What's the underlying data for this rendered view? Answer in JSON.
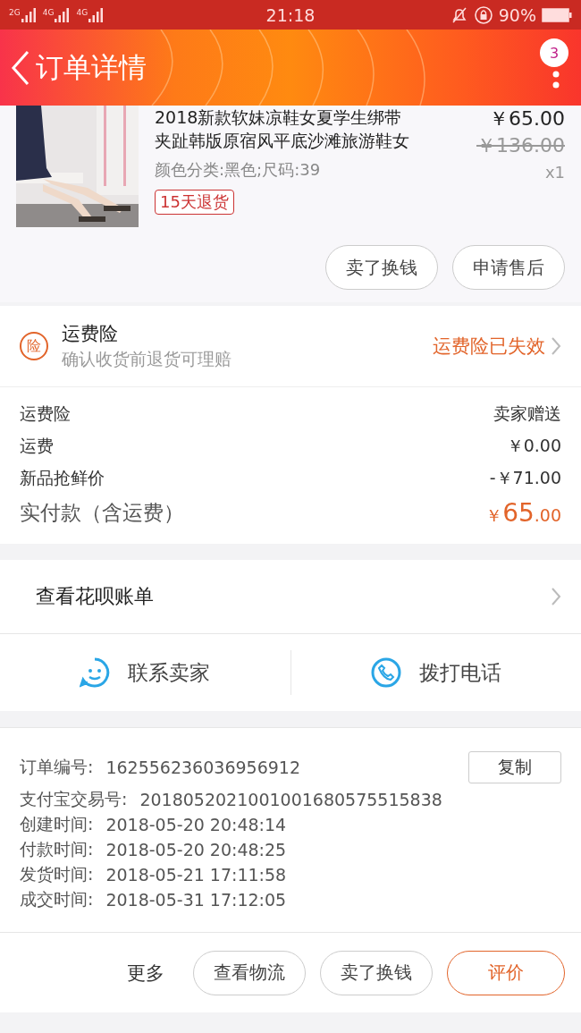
{
  "status_bar": {
    "network_1": "2G",
    "network_2": "4G",
    "network_3": "4G",
    "time": "21:18",
    "battery": "90%"
  },
  "header": {
    "title": "订单详情",
    "badge": "3"
  },
  "product": {
    "title_lines": [
      "2018新款软妹凉鞋女夏学生绑带",
      "夹趾韩版原宿风平底沙滩旅游鞋女"
    ],
    "spec": "颜色分类:黑色;尺码:39",
    "tag": "15天退货",
    "price": "￥65.00",
    "original_price": "￥136.00",
    "quantity": "x1",
    "buttons": [
      "卖了换钱",
      "申请售后"
    ]
  },
  "insurance": {
    "icon_text": "险",
    "title": "运费险",
    "subtitle": "确认收货前退货可理赔",
    "status": "运费险已失效"
  },
  "fees": [
    {
      "label": "运费险",
      "value": "卖家赠送"
    },
    {
      "label": "运费",
      "value": "￥0.00"
    },
    {
      "label": "新品抢鲜价",
      "value": "-￥71.00"
    }
  ],
  "total": {
    "label": "实付款（含运费）",
    "currency": "￥",
    "integer": "65",
    "decimal": ".00"
  },
  "huabei": {
    "label": "查看花呗账单"
  },
  "contact": [
    {
      "kind": "chat",
      "label": "联系卖家"
    },
    {
      "kind": "phone",
      "label": "拨打电话"
    }
  ],
  "order_info": [
    {
      "label": "订单编号:",
      "value": "162556236036956912",
      "action": "复制"
    },
    {
      "label": "支付宝交易号:",
      "value": "2018052021001001680575515838"
    },
    {
      "label": "创建时间:",
      "value": "2018-05-20 20:48:14"
    },
    {
      "label": "付款时间:",
      "value": "2018-05-20 20:48:25"
    },
    {
      "label": "发货时间:",
      "value": "2018-05-21 17:11:58"
    },
    {
      "label": "成交时间:",
      "value": "2018-05-31 17:12:05"
    }
  ],
  "bottom_bar": {
    "more": "更多",
    "buttons": [
      {
        "label": "查看物流",
        "primary": false
      },
      {
        "label": "卖了换钱",
        "primary": false
      },
      {
        "label": "评价",
        "primary": true
      }
    ]
  }
}
